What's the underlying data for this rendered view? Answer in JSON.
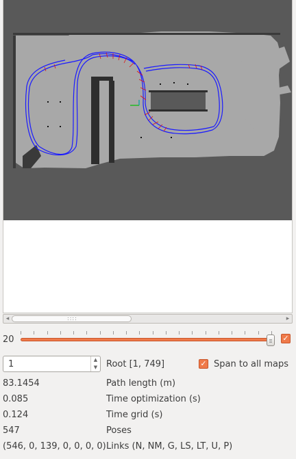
{
  "slider": {
    "label": "20",
    "value_fraction": 0.99
  },
  "spinbox": {
    "value": "1"
  },
  "root_label": "Root [1, 749]",
  "span_to_all_maps": {
    "label": "Span to all maps",
    "checked": true
  },
  "stats": [
    {
      "value": "83.1454",
      "label": "Path length (m)"
    },
    {
      "value": "0.085",
      "label": "Time optimization (s)"
    },
    {
      "value": "0.124",
      "label": "Time grid (s)"
    },
    {
      "value": "547",
      "label": "Poses"
    },
    {
      "value": "(546, 0, 139, 0, 0, 0, 0)",
      "label": "Links (N, NM, G, LS, LT, U, P)"
    }
  ],
  "colors": {
    "accent": "#ef7a4a",
    "trajectory": "#1a1aff",
    "links": "#e01010",
    "map_free": "#a8a8a8",
    "map_unknown": "#595959"
  }
}
